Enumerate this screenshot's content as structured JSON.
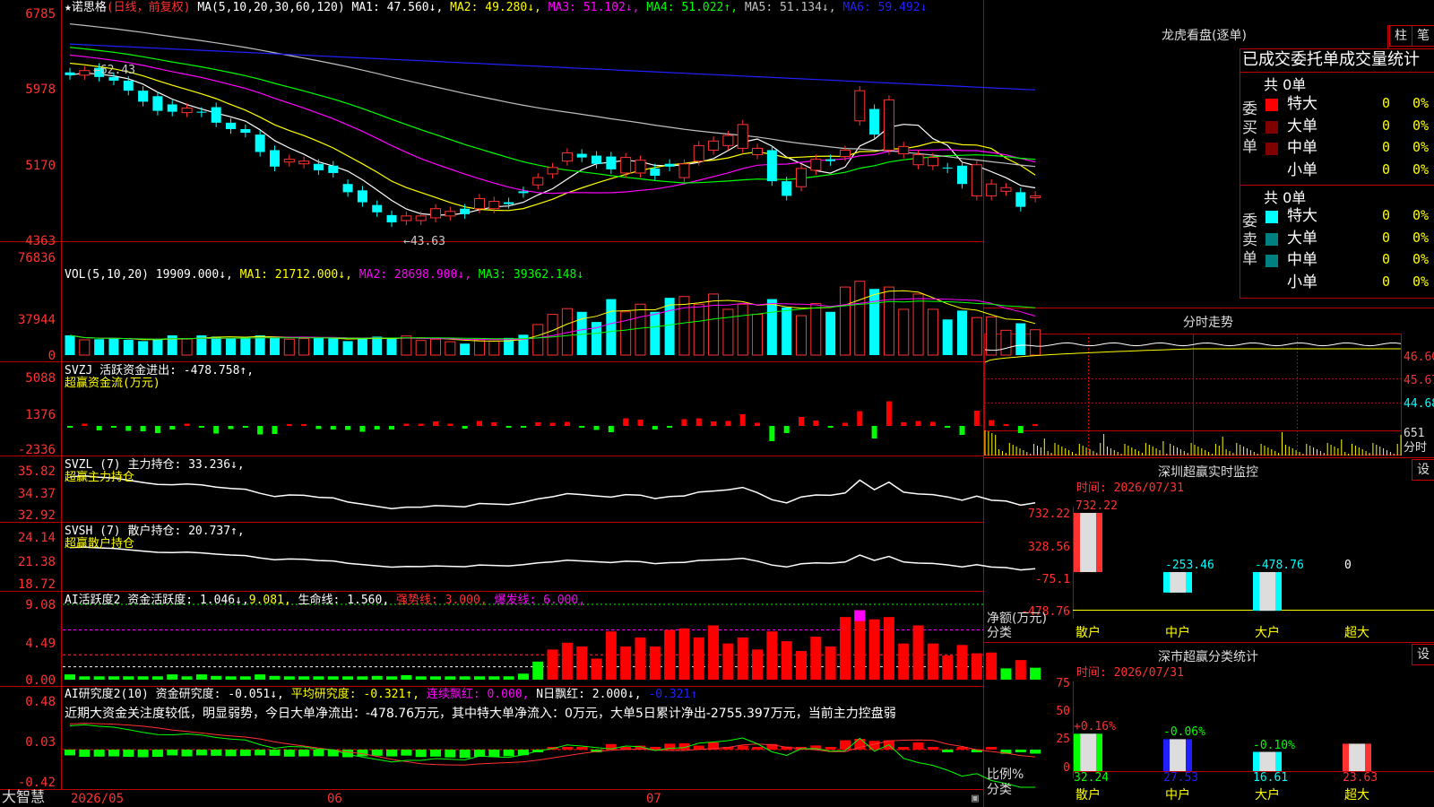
{
  "colors": {
    "up": "#ff3232",
    "down": "#00ffff",
    "grid": "#c00000",
    "ma1": "#ffffff",
    "ma2": "#ffff00",
    "ma3": "#ff00ff",
    "ma4": "#00ff00",
    "ma5": "#c0c0c0",
    "ma6": "#2020ff",
    "yellow": "#ffff00",
    "green": "#00ff00"
  },
  "header": {
    "star": "★",
    "stock": "诺思格",
    "mode": "(日线，前复权)",
    "ma_params": "MA(5,10,20,30,60,120)",
    "ma1": "MA1: 47.560↓,",
    "ma2": "MA2: 49.280↓,",
    "ma3": "MA3: 51.102↓,",
    "ma4": "MA4: 51.022↑,",
    "ma5": "MA5: 51.134↓,",
    "ma6": "MA6: 59.492↓"
  },
  "price_axis": [
    "6785",
    "5978",
    "5170",
    "4363"
  ],
  "annotations": {
    "high": "←62.43",
    "low": "←43.63"
  },
  "vol": {
    "label": "VOL(5,10,20)",
    "value": "19909.000↓,",
    "ma1": "MA1: 21712.000↓,",
    "ma2": "MA2: 28698.900↓,",
    "ma3": "MA3: 39362.148↓",
    "axis": [
      "76836",
      "37944",
      "0"
    ]
  },
  "svzj": {
    "line1": "SVZJ  活跃资金进出: -478.758↑,",
    "line2": "超赢资金流(万元)",
    "axis": [
      "5088",
      "1376",
      "-2336"
    ]
  },
  "svzl": {
    "line1": "SVZL (7) 主力持仓: 33.236↓,",
    "line2": "超赢主力持仓",
    "axis": [
      "35.82",
      "34.37",
      "32.92"
    ]
  },
  "svsh": {
    "line1": "SVSH (7) 散户持仓: 20.737↑,",
    "line2": "超赢散户持仓",
    "axis": [
      "24.14",
      "21.38",
      "18.72"
    ]
  },
  "ai2": {
    "a": "AI活跃度2 资金活跃度: 1.046↓,",
    "b": "9.081,",
    "c": "生命线: 1.560,",
    "d": "强势线: 3.000,",
    "e": "爆发线: 6.000,",
    "axis": [
      "9.08",
      "4.49",
      "0.00"
    ]
  },
  "ai3": {
    "a": "AI研究度2(10) 资金研究度: -0.051↓,",
    "b": "平均研究度: -0.321↑,",
    "c": "连续飘红: 0.000,",
    "d": "N日飘红: 2.000↓,",
    "e": "-0.321↑",
    "note": "近期大资金关注度较低，明显弱势，今日大单净流出：-478.76万元，其中特大单净流入：0万元，大单5日累计净出-2755.397万元，当前主力控盘弱",
    "axis": [
      "0.48",
      "0.03",
      "-0.42"
    ]
  },
  "date_axis": {
    "brand": "大智慧",
    "d1": "2026/05",
    "d2": "06",
    "d3": "07"
  },
  "chart_data": {
    "type": "candlestick",
    "title": "诺思格 (日线，前复权)",
    "ylim": [
      43.63,
      67.85
    ],
    "extremes": {
      "high": 62.43,
      "low": 43.63
    },
    "x": [
      "2026/05",
      "",
      "",
      "",
      "",
      "",
      "",
      "",
      "",
      "",
      "",
      "",
      "",
      "",
      "",
      "",
      "",
      "",
      "",
      "",
      "06",
      "",
      "",
      "",
      "",
      "",
      "",
      "",
      "",
      "",
      "",
      "",
      "",
      "",
      "",
      "",
      "",
      "",
      "",
      "",
      "",
      "07",
      "",
      "",
      "",
      "",
      "",
      "",
      "",
      "",
      "",
      "",
      "",
      "",
      "",
      "",
      "",
      "",
      "",
      "",
      "",
      "",
      ""
    ],
    "open": [
      61.5,
      61.2,
      62.0,
      61.0,
      60.6,
      59.5,
      58.9,
      58.0,
      57.1,
      57.2,
      57.7,
      56.0,
      55.3,
      54.7,
      53.0,
      51.7,
      51.5,
      51.5,
      51.3,
      49.3,
      48.6,
      47.0,
      45.9,
      45.3,
      45.3,
      45.6,
      45.8,
      46.6,
      46.6,
      46.6,
      47.3,
      48.5,
      49.2,
      50.4,
      51.8,
      52.6,
      52.4,
      52.3,
      50.5,
      50.5,
      51.0,
      51.5,
      50.0,
      51.8,
      53.0,
      53.5,
      53.2,
      52.5,
      53.0,
      49.6,
      49.0,
      50.8,
      52.0,
      52.3,
      56.2,
      57.5,
      53.0,
      52.6,
      51.4,
      51.3,
      51.1,
      51.3,
      48.0,
      48.0,
      48.5,
      48.4,
      47.8
    ],
    "close": [
      61.2,
      61.7,
      61.0,
      60.6,
      59.5,
      58.3,
      57.3,
      57.2,
      57.6,
      57.1,
      56.0,
      55.3,
      54.9,
      52.8,
      51.2,
      52.0,
      51.8,
      50.8,
      50.5,
      48.4,
      47.3,
      46.2,
      45.1,
      45.8,
      45.8,
      46.6,
      46.3,
      46.0,
      47.7,
      47.4,
      47.1,
      48.3,
      50.0,
      51.1,
      52.7,
      52.2,
      51.5,
      50.9,
      52.2,
      51.9,
      50.2,
      51.2,
      51.5,
      53.5,
      54.0,
      54.6,
      55.8,
      53.2,
      49.6,
      48.0,
      51.0,
      52.0,
      51.8,
      53.0,
      59.5,
      54.7,
      58.5,
      53.4,
      52.5,
      52.2,
      51.0,
      49.3,
      51.4,
      49.3,
      48.9,
      46.8,
      48.0
    ],
    "volume": [
      15500,
      12000,
      12500,
      13000,
      12000,
      11000,
      12000,
      15500,
      13000,
      15500,
      14500,
      13500,
      14000,
      15500,
      14500,
      12500,
      13000,
      13500,
      13000,
      11000,
      13500,
      14500,
      13000,
      15000,
      11500,
      12500,
      10500,
      9000,
      12000,
      11000,
      13500,
      16000,
      24000,
      32000,
      36500,
      34000,
      26000,
      44000,
      34000,
      40000,
      34000,
      45000,
      46000,
      40000,
      48000,
      36000,
      40000,
      32000,
      44000,
      37500,
      31000,
      40500,
      34000,
      53500,
      58000,
      52000,
      53500,
      36000,
      48000,
      36000,
      28000,
      35000,
      29500,
      30000,
      19500,
      25000,
      19909
    ]
  },
  "right": {
    "dragon": {
      "title": "龙虎看盘(逐单)",
      "btn1": "柱",
      "btn2": "笔",
      "headline": "已成交委托单成交量统计",
      "buy_label": "委买单",
      "sell_label": "委卖单",
      "buy_total": "共 0单",
      "sell_total": "共 0单",
      "rows": [
        {
          "name": "特大",
          "count": "0",
          "pct": "0%",
          "buy_color": "#ff0000",
          "sell_color": "#00ffff"
        },
        {
          "name": "大单",
          "count": "0",
          "pct": "0%",
          "buy_color": "#800000",
          "sell_color": "#008080"
        },
        {
          "name": "中单",
          "count": "0",
          "pct": "0%",
          "buy_color": "#800000",
          "sell_color": "#008080"
        },
        {
          "name": "小单",
          "count": "0",
          "pct": "0%",
          "buy_color": "#000000",
          "sell_color": "#000000"
        }
      ]
    },
    "fenshi": {
      "title": "分时走势",
      "axis": [
        "46.60",
        "45.67",
        "44.68"
      ],
      "vol_label": "651",
      "time_label": "分时"
    },
    "monitor": {
      "title": "深圳超赢实时监控",
      "btn": "设",
      "time": "时间: 2026/07/31",
      "axis": [
        "732.22",
        "328.56",
        "-75.1",
        "-478.76"
      ],
      "ylabel": "净额(万元)",
      "xlabel": "分类",
      "chart_data": {
        "type": "bar",
        "categories": [
          "散户",
          "中户",
          "大户",
          "超大"
        ],
        "values": [
          732.22,
          -253.46,
          -478.76,
          0
        ],
        "labels": [
          "732.22",
          "-253.46",
          "-478.76",
          "0"
        ],
        "ylim": [
          -478.76,
          732.22
        ]
      }
    },
    "classify": {
      "title": "深市超赢分类统计",
      "btn": "设",
      "time": "时间: 2026/07/31",
      "axis": [
        "75",
        "50",
        "25",
        "0"
      ],
      "ylabel": "比例%",
      "xlabel": "分类",
      "chart_data": {
        "type": "bar",
        "categories": [
          "散户",
          "中户",
          "大户",
          "超大"
        ],
        "values": [
          32.24,
          27.53,
          16.61,
          23.63
        ],
        "changes": [
          "+0.16%",
          "-0.06%",
          "-0.10%",
          ""
        ],
        "labels": [
          "32.24",
          "27.53",
          "16.61",
          "23.63"
        ],
        "ylim": [
          0,
          75
        ]
      }
    }
  }
}
